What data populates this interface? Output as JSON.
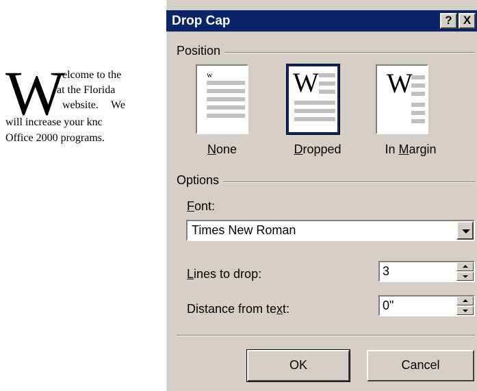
{
  "document": {
    "drop_cap": "W",
    "lines": [
      "elcome to the",
      "at the Florida",
      "website.",
      "We",
      "will increase your knc",
      "Office 2000 programs."
    ]
  },
  "dialog": {
    "title": "Drop Cap",
    "help_button": "?",
    "close_button": "X",
    "position": {
      "group_label": "Position",
      "options": [
        {
          "label": "None",
          "mnemonic": "N",
          "selected": false
        },
        {
          "label": "Dropped",
          "mnemonic": "D",
          "selected": true
        },
        {
          "label": "In Margin",
          "mnemonic": "M",
          "selected": false
        }
      ],
      "thumb_letter": "W",
      "thumb_small_letter": "w"
    },
    "options": {
      "group_label": "Options",
      "font_label": "Font:",
      "font_value": "Times New Roman",
      "lines_label": "Lines to drop:",
      "lines_value": "3",
      "distance_label": "Distance from text:",
      "distance_value": "0\""
    },
    "buttons": {
      "ok": "OK",
      "cancel": "Cancel"
    }
  },
  "colors": {
    "title_bar": "#0a246a",
    "dialog_bg": "#d4d0c8"
  }
}
